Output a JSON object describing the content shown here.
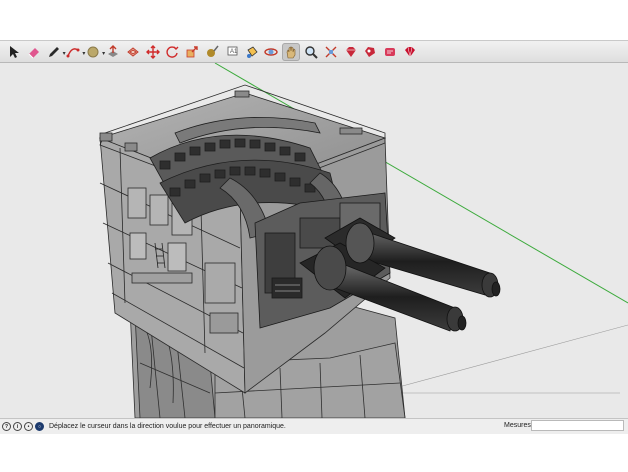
{
  "toolbar": {
    "tools": [
      {
        "name": "select-tool-icon",
        "glyph": "arrow",
        "color": "#222222"
      },
      {
        "name": "eraser-tool-icon",
        "glyph": "eraser",
        "color": "#e0578f"
      },
      {
        "name": "line-tool-icon",
        "glyph": "pencil",
        "color": "#2a2a2a",
        "dropdown": true
      },
      {
        "name": "arc-tool-icon",
        "glyph": "arc",
        "color": "#cc2a2a",
        "dropdown": true
      },
      {
        "name": "shape-tool-icon",
        "glyph": "circle",
        "color": "#8a7a4a",
        "dropdown": true
      },
      {
        "name": "push-pull-tool-icon",
        "glyph": "pushpull",
        "color": "#c23a2a"
      },
      {
        "name": "offset-tool-icon",
        "glyph": "offset",
        "color": "#c23a2a"
      },
      {
        "name": "move-tool-icon",
        "glyph": "move",
        "color": "#d02a2a"
      },
      {
        "name": "rotate-tool-icon",
        "glyph": "rotate",
        "color": "#d02a2a"
      },
      {
        "name": "scale-tool-icon",
        "glyph": "scale",
        "color": "#c83a2a"
      },
      {
        "name": "tape-measure-tool-icon",
        "glyph": "tape",
        "color": "#b08a2a"
      },
      {
        "name": "text-tool-icon",
        "glyph": "text",
        "color": "#555555"
      },
      {
        "name": "paint-bucket-tool-icon",
        "glyph": "bucket",
        "color": "#3a78c8"
      },
      {
        "name": "orbit-tool-icon",
        "glyph": "orbit",
        "color": "#c23a2a"
      },
      {
        "name": "pan-tool-icon",
        "glyph": "hand",
        "color": "#d8b87a",
        "active": true
      },
      {
        "name": "zoom-tool-icon",
        "glyph": "zoom",
        "color": "#333333"
      },
      {
        "name": "zoom-extents-tool-icon",
        "glyph": "extents",
        "color": "#c23a2a"
      },
      {
        "name": "3d-warehouse-icon",
        "glyph": "gem",
        "color": "#c8283a"
      },
      {
        "name": "extension-warehouse-icon",
        "glyph": "gem2",
        "color": "#c8283a"
      },
      {
        "name": "layout-icon",
        "glyph": "gem3",
        "color": "#d83a5a"
      },
      {
        "name": "ruby-extension-icon",
        "glyph": "gem4",
        "color": "#c8102e"
      }
    ]
  },
  "status": {
    "hint": "Déplacez le curseur dans la direction voulue pour effectuer un panoramique.",
    "measures_label": "Mesures",
    "measures_value": ""
  },
  "status_icons": [
    {
      "name": "help-icon",
      "glyph": "?"
    },
    {
      "name": "info-icon",
      "glyph": "i"
    },
    {
      "name": "user-account-icon",
      "glyph": "•"
    },
    {
      "name": "instructor-icon",
      "glyph": "○",
      "dark": true
    }
  ],
  "colors": {
    "viewport_bg": "#e9e9e9",
    "model_face": "#a8a8a8",
    "model_dark": "#3a3a3a",
    "axis_green": "#3caa3c"
  }
}
